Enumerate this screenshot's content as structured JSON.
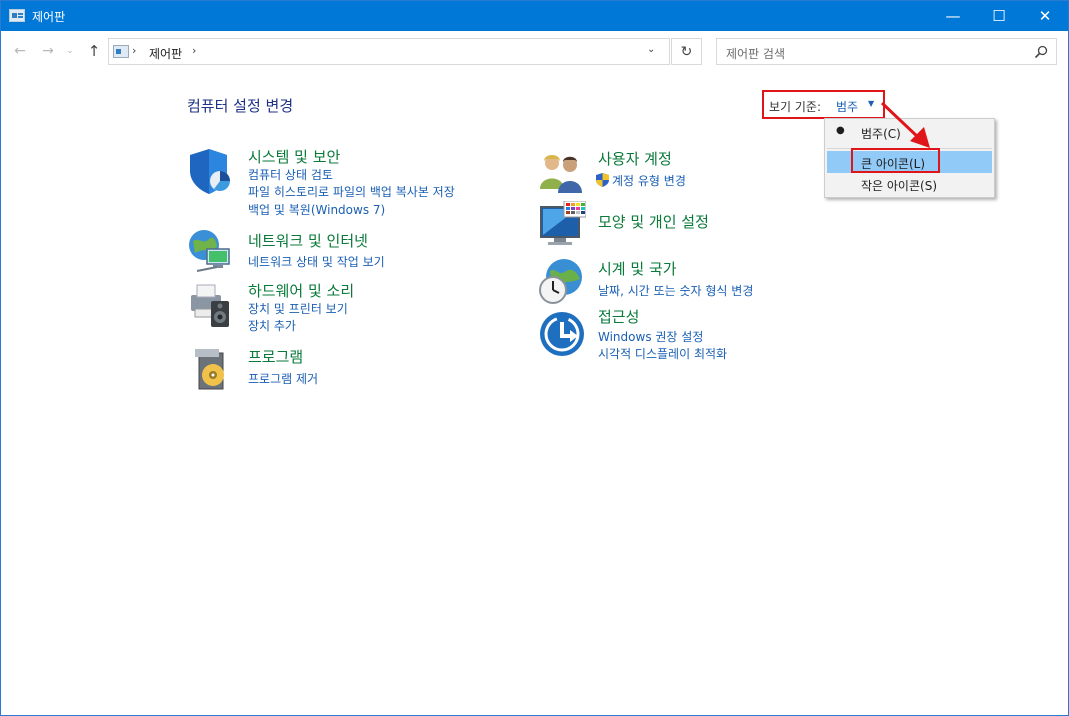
{
  "window": {
    "title": "제어판",
    "controls": {
      "minimize": "—",
      "maximize": "☐",
      "close": "✕"
    }
  },
  "nav": {
    "back": "←",
    "forward": "→",
    "recent": "⌄",
    "up": "↑",
    "refresh": "↻"
  },
  "address": {
    "separator": "›",
    "crumb": "제어판",
    "dropdown": "⌄"
  },
  "search": {
    "placeholder": "제어판 검색"
  },
  "page_title": "컴퓨터 설정 변경",
  "view_by": {
    "label": "보기 기준:",
    "value": "범주",
    "arrow": "▼"
  },
  "view_menu": {
    "items": [
      {
        "label": "범주(C)",
        "selected": true,
        "bullet": "●"
      },
      {
        "label": "큰 아이콘(L)",
        "highlighted": true
      },
      {
        "label": "작은 아이콘(S)"
      }
    ]
  },
  "colors": {
    "titlebar": "#0078d7",
    "link": "#1a5fb4",
    "category_title": "#0a7a3a",
    "annotation": "#e0151a"
  },
  "categories": {
    "system": {
      "icon": "security-shield-icon",
      "title": "시스템 및 보안",
      "links": [
        "컴퓨터 상태 검토",
        "파일 히스토리로 파일의 백업 복사본 저장",
        "백업 및 복원(Windows 7)"
      ]
    },
    "network": {
      "icon": "network-globe-icon",
      "title": "네트워크 및 인터넷",
      "links": [
        "네트워크 상태 및 작업 보기"
      ]
    },
    "hardware": {
      "icon": "printer-speaker-icon",
      "title": "하드웨어 및 소리",
      "links": [
        "장치 및 프린터 보기",
        "장치 추가"
      ]
    },
    "programs": {
      "icon": "program-disc-icon",
      "title": "프로그램",
      "links": [
        "프로그램 제거"
      ]
    },
    "users": {
      "icon": "users-icon",
      "title": "사용자 계정",
      "links": [
        "계정 유형 변경"
      ]
    },
    "appearance": {
      "icon": "monitor-palette-icon",
      "title": "모양 및 개인 설정",
      "links": []
    },
    "clock": {
      "icon": "clock-globe-icon",
      "title": "시계 및 국가",
      "links": [
        "날짜, 시간 또는 숫자 형식 변경"
      ]
    },
    "access": {
      "icon": "accessibility-icon",
      "title": "접근성",
      "links": [
        "Windows 권장 설정",
        "시각적 디스플레이 최적화"
      ]
    }
  }
}
